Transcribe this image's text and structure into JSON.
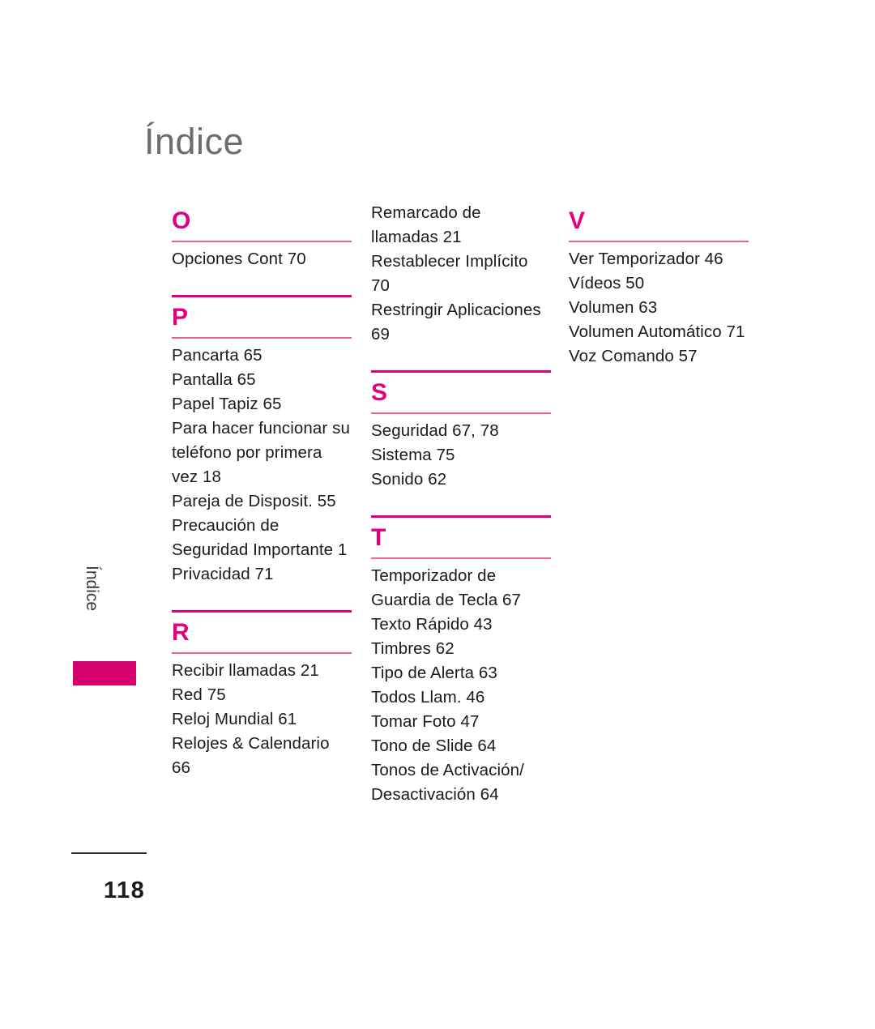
{
  "document": {
    "title": "Índice",
    "page_number": "118",
    "side_tab_label": "Índice",
    "accent_color": "#e2007e",
    "accent_light_color": "#ef5fa0",
    "tab_block_color": "#d6006e",
    "title_color": "#6d6d6d"
  },
  "columns": [
    {
      "sections": [
        {
          "letter": "O",
          "has_rule_above": false,
          "entries": [
            "Opciones Cont 70"
          ]
        },
        {
          "letter": "P",
          "has_rule_above": true,
          "entries": [
            "Pancarta 65",
            "Pantalla 65",
            "Papel Tapiz 65",
            "Para hacer funcionar su teléfono por primera vez 18",
            "Pareja de Disposit. 55",
            "Precaución de Seguridad Importante 1",
            "Privacidad 71"
          ]
        },
        {
          "letter": "R",
          "has_rule_above": true,
          "entries": [
            "Recibir llamadas 21",
            "Red 75",
            "Reloj Mundial 61",
            "Relojes & Calendario 66"
          ]
        }
      ]
    },
    {
      "continuation_entries": [
        "Remarcado de llamadas 21",
        "Restablecer Implícito 70",
        "Restringir Aplicaciones 69"
      ],
      "sections": [
        {
          "letter": "S",
          "has_rule_above": true,
          "entries": [
            "Seguridad 67, 78",
            "Sistema 75",
            "Sonido 62"
          ]
        },
        {
          "letter": "T",
          "has_rule_above": true,
          "entries": [
            "Temporizador de Guardia de Tecla 67",
            "Texto Rápido 43",
            "Timbres 62",
            "Tipo de Alerta 63",
            "Todos Llam. 46",
            "Tomar Foto 47",
            "Tono de Slide 64",
            "Tonos de Activación/ Desactivación 64"
          ]
        }
      ]
    },
    {
      "sections": [
        {
          "letter": "V",
          "has_rule_above": false,
          "entries": [
            "Ver Temporizador 46",
            "Vídeos 50",
            "Volumen 63",
            "Volumen Automático 71",
            "Voz Comando 57"
          ]
        }
      ]
    }
  ]
}
